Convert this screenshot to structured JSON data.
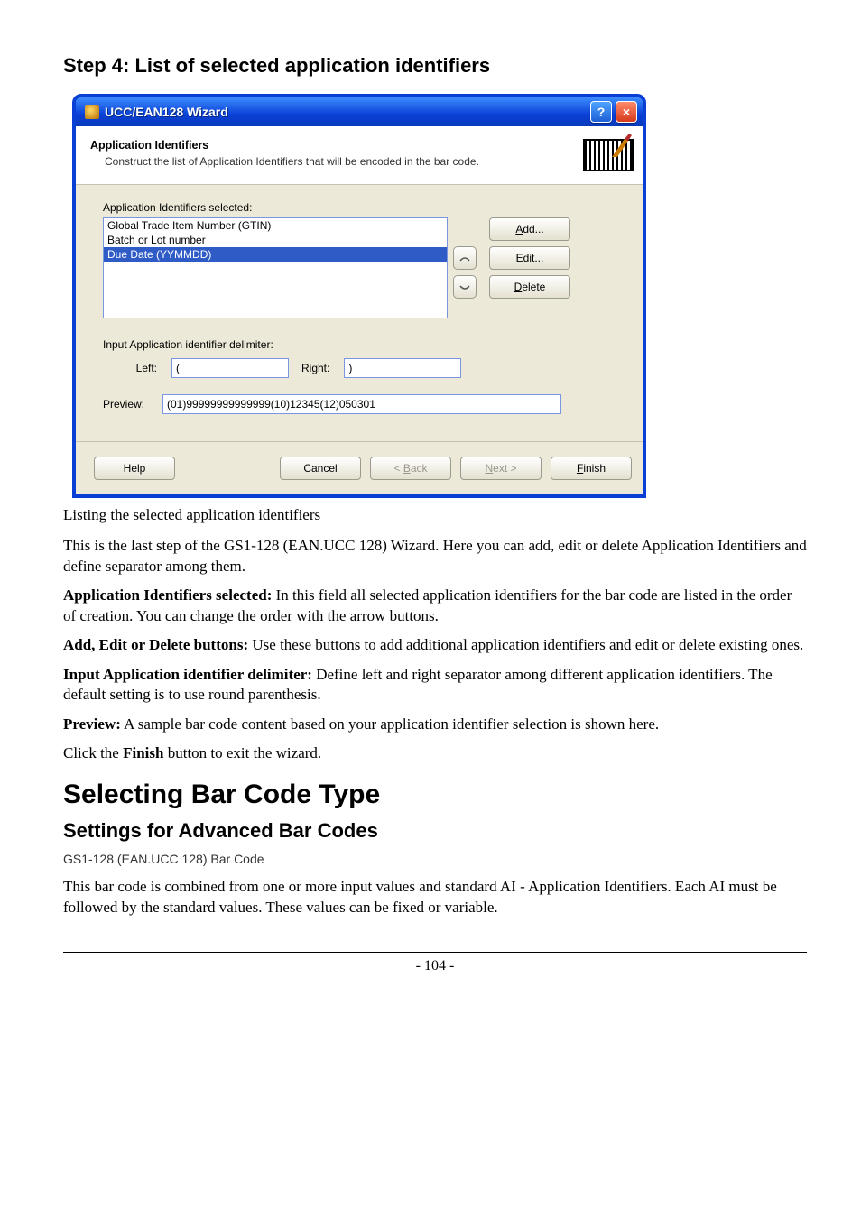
{
  "headings": {
    "step": "Step 4: List of selected application identifiers",
    "selecting": "Selecting Bar Code Type",
    "settings": "Settings for Advanced Bar Codes",
    "gs1": "GS1-128 (EAN.UCC 128) Bar Code"
  },
  "wizard": {
    "title": "UCC/EAN128 Wizard",
    "help_glyph": "?",
    "close_glyph": "×",
    "header_title": "Application Identifiers",
    "header_sub": "Construct the list of Application Identifiers that will be encoded in the bar code.",
    "selected_label": "Application Identifiers selected:",
    "items": [
      "Global Trade Item Number (GTIN)",
      "Batch or Lot number",
      "Due Date (YYMMDD)"
    ],
    "buttons": {
      "add_pre": "A",
      "add_ul": "A",
      "add_rest": "dd...",
      "edit_ul": "E",
      "edit_rest": "dit...",
      "delete_ul": "D",
      "delete_rest": "elete"
    },
    "delimiter_label": "Input Application identifier delimiter:",
    "left_label": "Left:",
    "right_label": "Right:",
    "left_value": "(",
    "right_value": ")",
    "preview_label": "Preview:",
    "preview_value": "(01)99999999999999(10)12345(12)050301",
    "footer": {
      "help": "Help",
      "cancel": "Cancel",
      "back_pre": "< ",
      "back_ul": "B",
      "back_rest": "ack",
      "next_ul": "N",
      "next_rest": "ext >",
      "finish_ul": "F",
      "finish_rest": "inish"
    }
  },
  "body": {
    "caption": "Listing the selected application identifiers",
    "p_intro": "This is the last step of the GS1-128 (EAN.UCC 128) Wizard. Here you can add, edit or delete Application Identifiers and define separator among them.",
    "p_sel_b": "Application Identifiers selected:",
    "p_sel_r": " In this field all selected application identifiers for the bar code are listed in the order of creation. You can change the order with the arrow buttons.",
    "p_btn_b": "Add, Edit or Delete buttons:",
    "p_btn_r": " Use these buttons to add additional application identifiers and edit or delete existing ones.",
    "p_delim_b": "Input Application identifier delimiter:",
    "p_delim_r": " Define left and right separator among different application identifiers. The default setting is to use round parenthesis.",
    "p_prev_b": "Preview:",
    "p_prev_r": " A sample bar code content based on your application identifier selection is shown here.",
    "p_click_a": "Click the ",
    "p_click_b": "Finish",
    "p_click_c": " button to exit the wizard.",
    "p_gs1": "This bar code is combined from one or more input values and standard AI - Application Identifiers. Each AI must be followed by the standard values. These values can be fixed or variable.",
    "page_number": "- 104 -"
  }
}
